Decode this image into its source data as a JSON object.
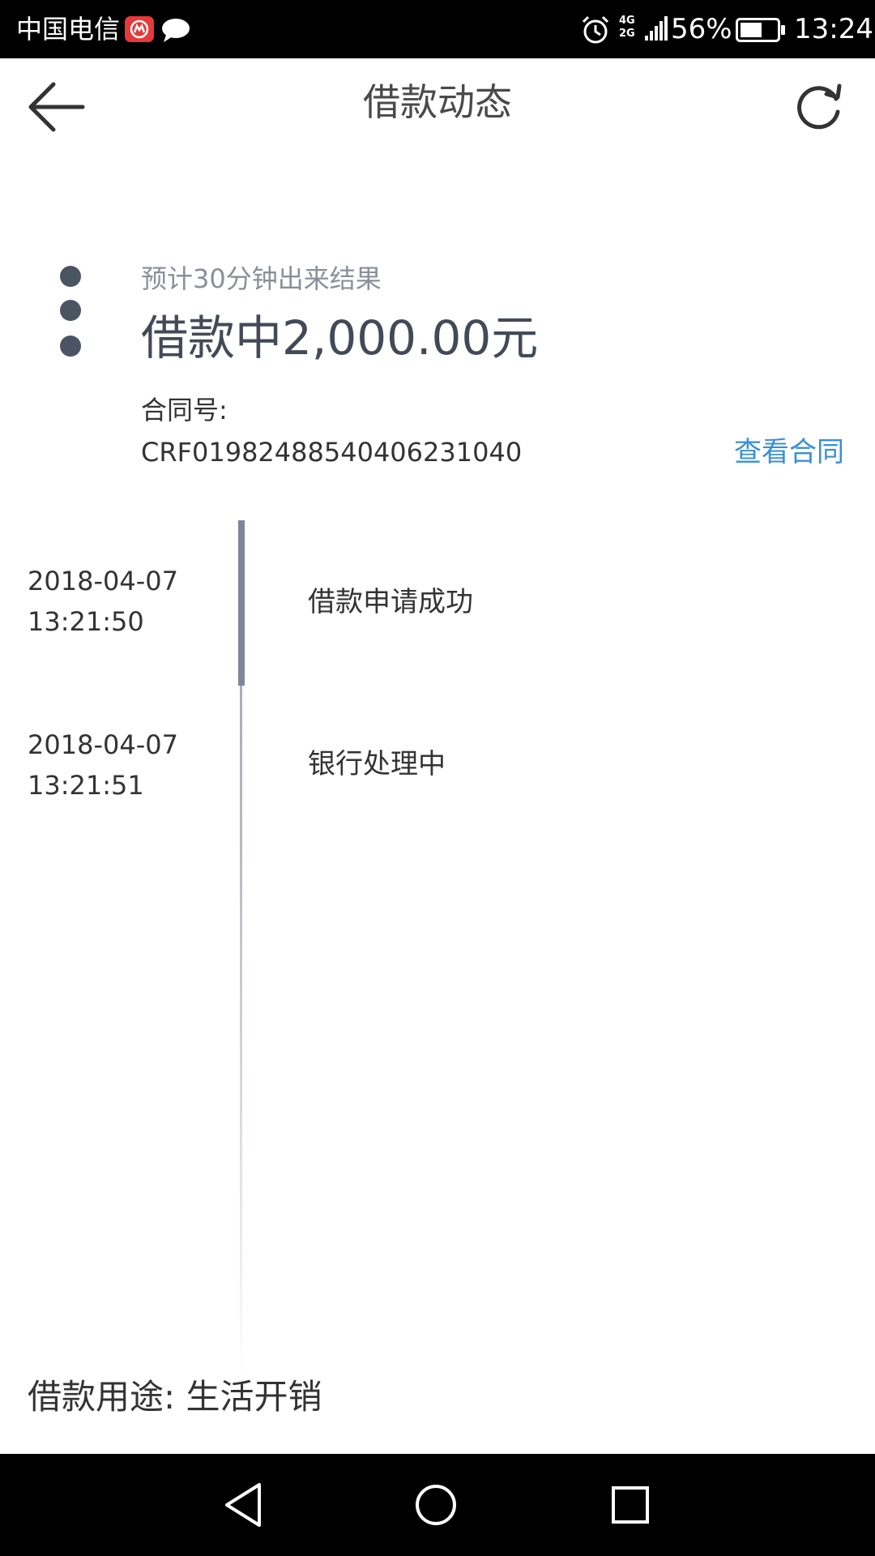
{
  "status_bar": {
    "carrier": "中国电信",
    "network_type_top": "4G",
    "network_type_bottom": "2G",
    "battery_percent": "56%",
    "time": "13:24",
    "icons": [
      "carrier-app-icon",
      "chat-bubble-icon",
      "alarm-icon",
      "signal-icon",
      "battery-icon"
    ]
  },
  "header": {
    "title": "借款动态",
    "back_icon": "arrow-left-icon",
    "refresh_icon": "refresh-icon"
  },
  "summary": {
    "estimate": "预计30分钟出来结果",
    "status_amount": "借款中2,000.00元",
    "contract_label": "合同号:",
    "contract_number": "CRF01982488540406231040",
    "view_contract": "查看合同",
    "link_color": "#3a8fd6",
    "dot_color": "#4b5463"
  },
  "timeline": {
    "events": [
      {
        "date": "2018-04-07",
        "time": "13:21:50",
        "description": "借款申请成功"
      },
      {
        "date": "2018-04-07",
        "time": "13:21:51",
        "description": "银行处理中"
      }
    ]
  },
  "footer": {
    "loan_purpose": "借款用途: 生活开销"
  },
  "nav_bar": {
    "icons": [
      "nav-back-icon",
      "nav-home-icon",
      "nav-recents-icon"
    ]
  }
}
